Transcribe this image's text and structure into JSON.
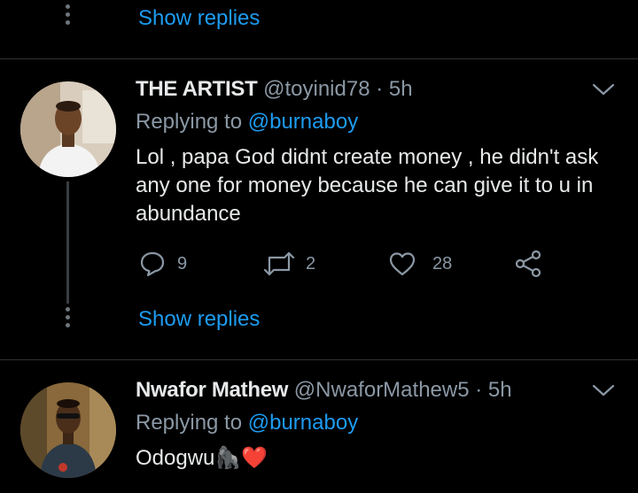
{
  "top": {
    "show_replies": "Show replies"
  },
  "tweet1": {
    "name": "THE ARTIST",
    "handle": "@toyinid78",
    "dot": "·",
    "time": "5h",
    "replying_prefix": "Replying to",
    "replying_to": "@burnaboy",
    "text": "Lol , papa God didnt create money , he didn't ask any one for money because he can give it to u in abundance",
    "replies": "9",
    "retweets": "2",
    "likes": "28",
    "show_replies": "Show replies"
  },
  "tweet2": {
    "name": "Nwafor Mathew",
    "handle": "@NwaforMathew5",
    "dot": "·",
    "time": "5h",
    "replying_prefix": "Replying to",
    "replying_to": "@burnaboy",
    "text": "Odogwu",
    "emoji1": "🦍",
    "emoji2": "❤️"
  },
  "colors": {
    "accent": "#1d9bf0",
    "muted": "#8b98a5",
    "background": "#000000",
    "heart": "#e0245e"
  },
  "icons": [
    "reply-icon",
    "retweet-icon",
    "like-icon",
    "share-icon",
    "chevron-down-icon",
    "more-dots-icon"
  ]
}
